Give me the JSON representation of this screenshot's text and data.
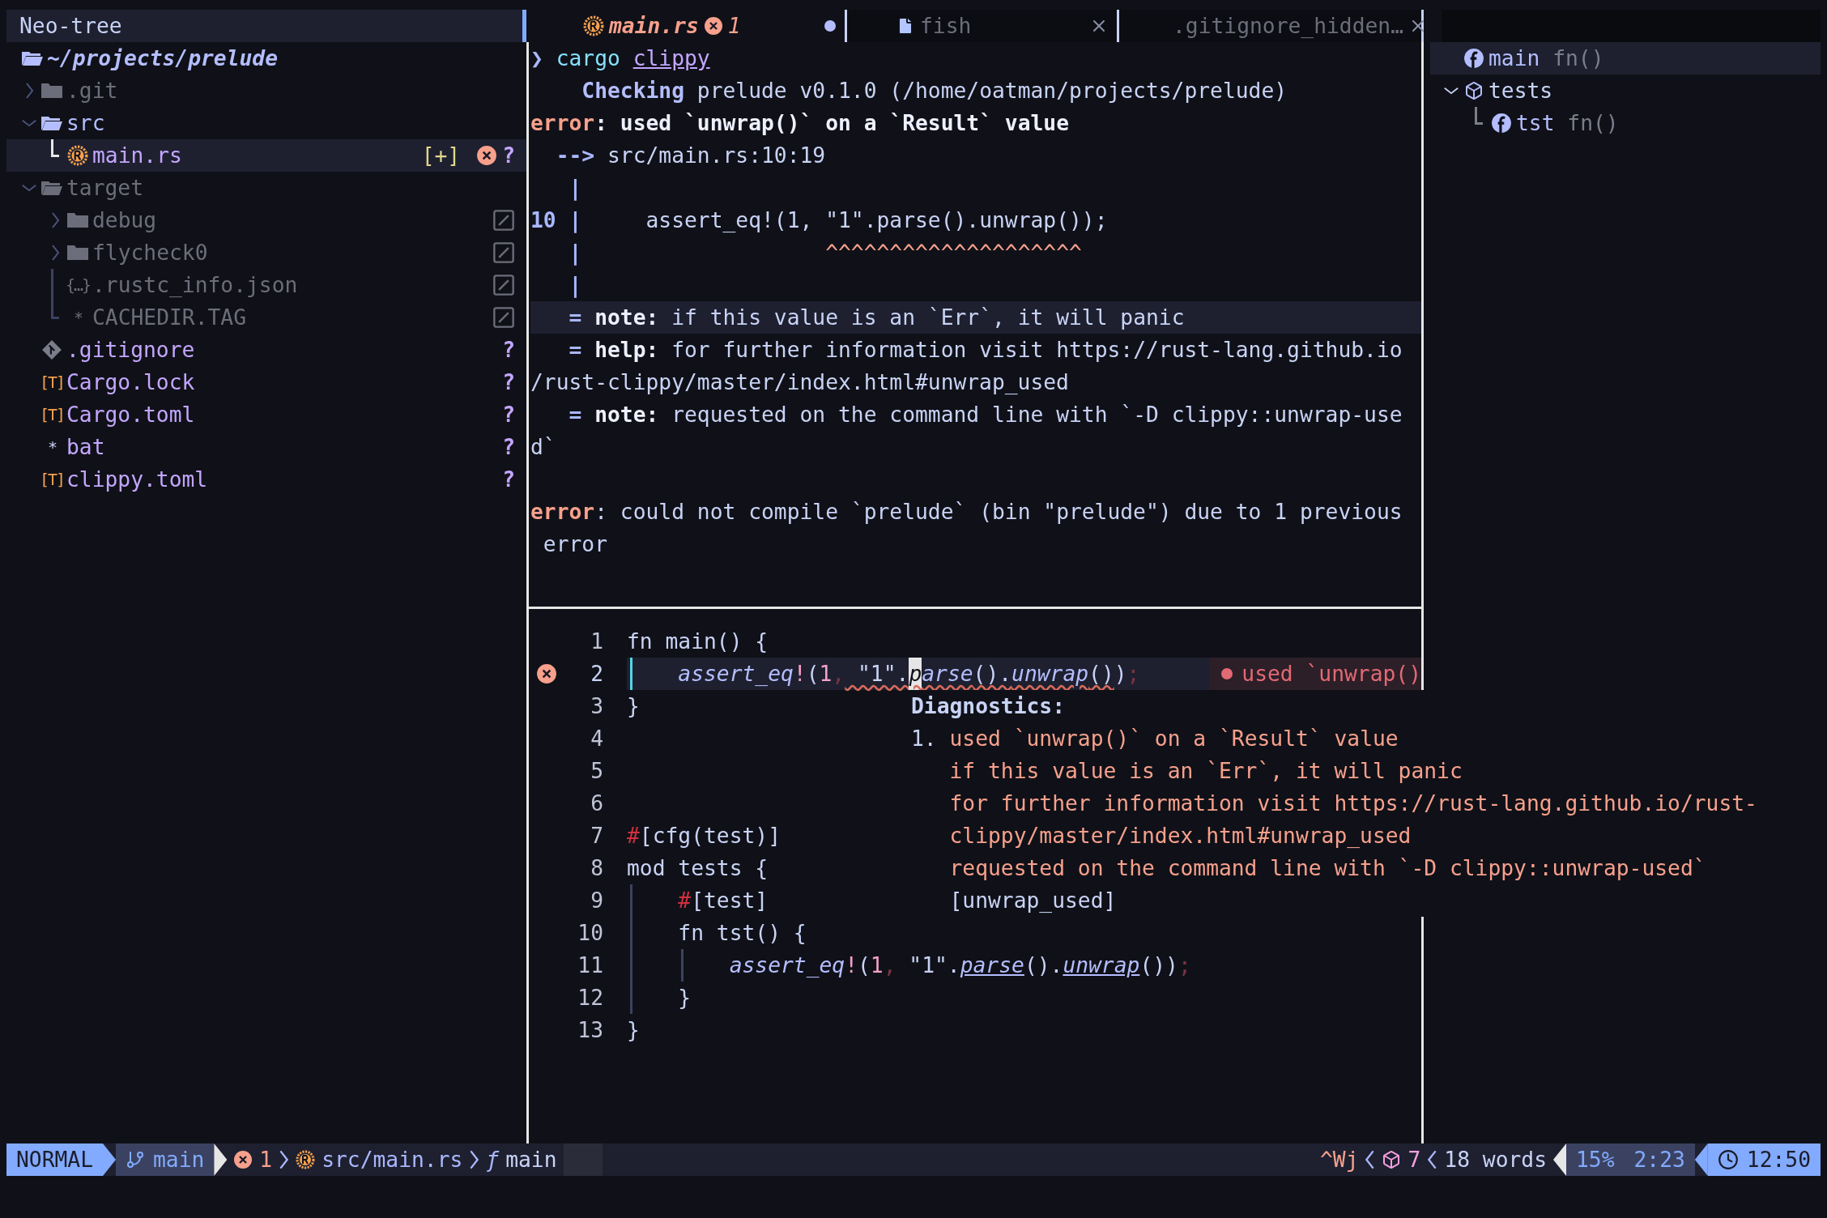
{
  "tree": {
    "title": "Neo-tree",
    "root": "~/projects/prelude",
    "items": [
      {
        "kind": "folder",
        "name": ".git",
        "expanded": false,
        "dimmed": true,
        "ignored": false,
        "selected": false
      },
      {
        "kind": "folder",
        "name": "src",
        "expanded": true,
        "dimmed": false,
        "ignored": false,
        "selected": false,
        "children": [
          {
            "kind": "rust",
            "name": "main.rs",
            "dimmed": false,
            "ignored": false,
            "selected": true,
            "modified": "[+]",
            "error": true,
            "git": "?"
          }
        ]
      },
      {
        "kind": "folder",
        "name": "target",
        "expanded": true,
        "dimmed": true,
        "ignored": false,
        "selected": false,
        "children": [
          {
            "kind": "folder",
            "name": "debug",
            "expanded": false,
            "dimmed": true,
            "ignored": true,
            "selected": false
          },
          {
            "kind": "folder",
            "name": "flycheck0",
            "expanded": false,
            "dimmed": true,
            "ignored": true,
            "selected": false
          },
          {
            "kind": "glyph",
            "glyph": "{…}",
            "name": ".rustc_info.json",
            "dimmed": true,
            "ignored": true,
            "selected": false
          },
          {
            "kind": "glyph",
            "glyph": "*",
            "name": "CACHEDIR.TAG",
            "dimmed": true,
            "ignored": true,
            "selected": false
          }
        ]
      },
      {
        "kind": "git",
        "name": ".gitignore",
        "dimmed": false,
        "ignored": false,
        "selected": false,
        "git": "?"
      },
      {
        "kind": "glyph",
        "glyph": "[T]",
        "name": "Cargo.lock",
        "dimmed": false,
        "ignored": false,
        "selected": false,
        "git": "?"
      },
      {
        "kind": "glyph",
        "glyph": "[T]",
        "name": "Cargo.toml",
        "dimmed": false,
        "ignored": false,
        "selected": false,
        "git": "?"
      },
      {
        "kind": "glyph",
        "glyph": "*",
        "name": "bat",
        "dimmed": false,
        "ignored": false,
        "selected": false,
        "git": "?"
      },
      {
        "kind": "glyph",
        "glyph": "[T]",
        "name": "clippy.toml",
        "dimmed": false,
        "ignored": false,
        "selected": false,
        "git": "?"
      }
    ]
  },
  "tabs": [
    {
      "kind": "rust",
      "label": "main.rs",
      "selected": true,
      "errors": "1",
      "modified": true
    },
    {
      "kind": "file",
      "label": "fish",
      "selected": false,
      "modified": false
    },
    {
      "kind": "file",
      "label": ".gitignore_hidden…",
      "selected": false,
      "modified": false
    }
  ],
  "terminal": {
    "lines": [
      {
        "current": false,
        "segments": [
          {
            "text": "❯",
            "kind": "prompt"
          },
          {
            "text": " cargo ",
            "kind": "command"
          },
          {
            "text": "clippy",
            "kind": "link"
          }
        ]
      },
      {
        "current": false,
        "segments": [
          {
            "text": "    Checking",
            "kind": "heading"
          },
          {
            "text": " prelude v0.1.0 (/home/oatman/projects/prelude)",
            "kind": "plain"
          }
        ]
      },
      {
        "current": false,
        "segments": [
          {
            "text": "error",
            "kind": "error"
          },
          {
            "text": ": used `unwrap()` on a `Result` value",
            "kind": "bold"
          }
        ]
      },
      {
        "current": false,
        "segments": [
          {
            "text": "  -->",
            "kind": "gutter"
          },
          {
            "text": " src/main.rs:10:19",
            "kind": "plain"
          }
        ]
      },
      {
        "current": false,
        "segments": [
          {
            "text": "   |",
            "kind": "gutter"
          }
        ]
      },
      {
        "current": false,
        "segments": [
          {
            "text": "10 |",
            "kind": "gutter"
          },
          {
            "text": "     assert_eq!(1, \"1\".parse().unwrap());",
            "kind": "plain"
          }
        ]
      },
      {
        "current": false,
        "segments": [
          {
            "text": "   |",
            "kind": "gutter"
          },
          {
            "text": "                   ^^^^^^^^^^^^^^^^^^^^",
            "kind": "carets"
          }
        ]
      },
      {
        "current": false,
        "segments": [
          {
            "text": "   |",
            "kind": "gutter"
          }
        ]
      },
      {
        "current": true,
        "segments": [
          {
            "text": "   =",
            "kind": "gutter"
          },
          {
            "text": " note:",
            "kind": "bold"
          },
          {
            "text": " if this value is an `Err`, it will panic",
            "kind": "plain"
          }
        ]
      },
      {
        "current": false,
        "segments": [
          {
            "text": "   =",
            "kind": "gutter"
          },
          {
            "text": " help:",
            "kind": "bold"
          },
          {
            "text": " for further information visit https://rust-lang.github.io",
            "kind": "plain"
          }
        ]
      },
      {
        "current": false,
        "segments": [
          {
            "text": "/rust-clippy/master/index.html#unwrap_used",
            "kind": "plain"
          }
        ]
      },
      {
        "current": false,
        "segments": [
          {
            "text": "   =",
            "kind": "gutter"
          },
          {
            "text": " note:",
            "kind": "bold"
          },
          {
            "text": " requested on the command line with `-D clippy::unwrap-use",
            "kind": "plain"
          }
        ]
      },
      {
        "current": false,
        "segments": [
          {
            "text": "d`",
            "kind": "plain"
          }
        ]
      },
      {
        "current": false
      },
      {
        "current": false,
        "segments": [
          {
            "text": "error",
            "kind": "error"
          },
          {
            "text": ": could not compile `prelude` (bin \"prelude\") due to 1 previous",
            "kind": "plain"
          }
        ]
      },
      {
        "current": false,
        "segments": [
          {
            "text": " error",
            "kind": "plain"
          }
        ]
      }
    ]
  },
  "editor": {
    "lines": [
      {
        "number": "1",
        "error": false,
        "current": false,
        "segments": [
          {
            "text": "fn main() {",
            "kind": "plain"
          }
        ]
      },
      {
        "number": "2",
        "error": true,
        "current": true,
        "diagnostic": "used `unwrap()",
        "indent_guides": [
          {
            "active": true
          }
        ],
        "segments": [
          {
            "text": "assert_eq",
            "kind": "macro"
          },
          {
            "text": "!",
            "kind": "bang"
          },
          {
            "text": "(",
            "kind": "plain"
          },
          {
            "text": "1",
            "kind": "number"
          },
          {
            "text": ",",
            "kind": "punct"
          },
          {
            "text": " \"1\".",
            "kind": "plain",
            "wavy": true
          },
          {
            "text": "p",
            "kind": "method",
            "wavy": true,
            "cursor": true
          },
          {
            "text": "arse",
            "kind": "method",
            "wavy": true
          },
          {
            "text": "().",
            "kind": "plain",
            "wavy": true
          },
          {
            "text": "unwrap",
            "kind": "method",
            "wavy": true
          },
          {
            "text": "()",
            "kind": "plain",
            "wavy": true
          },
          {
            "text": ")",
            "kind": "plain"
          },
          {
            "text": ";",
            "kind": "punct"
          }
        ]
      },
      {
        "number": "3",
        "error": false,
        "current": false,
        "segments": [
          {
            "text": "}",
            "kind": "plain"
          }
        ]
      },
      {
        "number": "4",
        "error": false,
        "current": false
      },
      {
        "number": "5",
        "error": false,
        "current": false
      },
      {
        "number": "6",
        "error": false,
        "current": false
      },
      {
        "number": "7",
        "error": false,
        "current": false,
        "segments": [
          {
            "text": "#",
            "kind": "hash"
          },
          {
            "text": "[cfg(test)]",
            "kind": "plain"
          }
        ]
      },
      {
        "number": "8",
        "error": false,
        "current": false,
        "segments": [
          {
            "text": "mod tests {",
            "kind": "plain"
          }
        ]
      },
      {
        "number": "9",
        "error": false,
        "current": false,
        "indent_guides": [
          {
            "active": false
          }
        ],
        "segments": [
          {
            "text": "#",
            "kind": "hash"
          },
          {
            "text": "[test]",
            "kind": "plain"
          }
        ]
      },
      {
        "number": "10",
        "error": false,
        "current": false,
        "indent_guides": [
          {
            "active": false
          }
        ],
        "segments": [
          {
            "text": "fn tst() {",
            "kind": "plain"
          }
        ]
      },
      {
        "number": "11",
        "error": false,
        "current": false,
        "indent_guides": [
          {
            "active": false
          },
          {
            "active": false
          }
        ],
        "segments": [
          {
            "text": "assert_eq",
            "kind": "macro"
          },
          {
            "text": "!",
            "kind": "bang"
          },
          {
            "text": "(",
            "kind": "plain"
          },
          {
            "text": "1",
            "kind": "number"
          },
          {
            "text": ",",
            "kind": "punct"
          },
          {
            "text": " \"1\".",
            "kind": "plain"
          },
          {
            "text": "parse",
            "kind": "method"
          },
          {
            "text": "().",
            "kind": "plain"
          },
          {
            "text": "unwrap",
            "kind": "method"
          },
          {
            "text": "())",
            "kind": "plain"
          },
          {
            "text": ";",
            "kind": "punct"
          }
        ]
      },
      {
        "number": "12",
        "error": false,
        "current": false,
        "indent_guides": [
          {
            "active": false
          }
        ],
        "segments": [
          {
            "text": "}",
            "kind": "plain"
          }
        ]
      },
      {
        "number": "13",
        "error": false,
        "current": false,
        "segments": [
          {
            "text": "}",
            "kind": "plain"
          }
        ]
      }
    ]
  },
  "diagnostics_float": {
    "title": "Diagnostics:",
    "lines": [
      {
        "kind": "numbered",
        "prefix": "1.",
        "text": "used `unwrap()` on a `Result` value"
      },
      {
        "kind": "message",
        "text": "if this value is an `Err`, it will panic"
      },
      {
        "kind": "message",
        "text": "for further information visit https://rust-lang.github.io/rust-"
      },
      {
        "kind": "message",
        "text": "clippy/master/index.html#unwrap_used"
      },
      {
        "kind": "message",
        "text": "requested on the command line with `-D clippy::unwrap-used`"
      },
      {
        "kind": "code",
        "text": "[unwrap_used]"
      }
    ]
  },
  "outline": {
    "items": [
      {
        "kind": "function",
        "name": "main",
        "detail": "fn()",
        "selected": true
      },
      {
        "kind": "module",
        "name": "tests",
        "expanded": true,
        "selected": false,
        "children": [
          {
            "kind": "function",
            "name": "tst",
            "detail": "fn()",
            "selected": false
          }
        ]
      }
    ]
  },
  "status": {
    "mode": "NORMAL",
    "branch": "main",
    "errors": "1",
    "file": "src/main.rs",
    "symbol_glyph": "ƒ",
    "symbol": "main",
    "keys": "^Wj",
    "packages": "7",
    "words": "18 words",
    "progress": "15%",
    "position": "2:23",
    "time": "12:50"
  }
}
